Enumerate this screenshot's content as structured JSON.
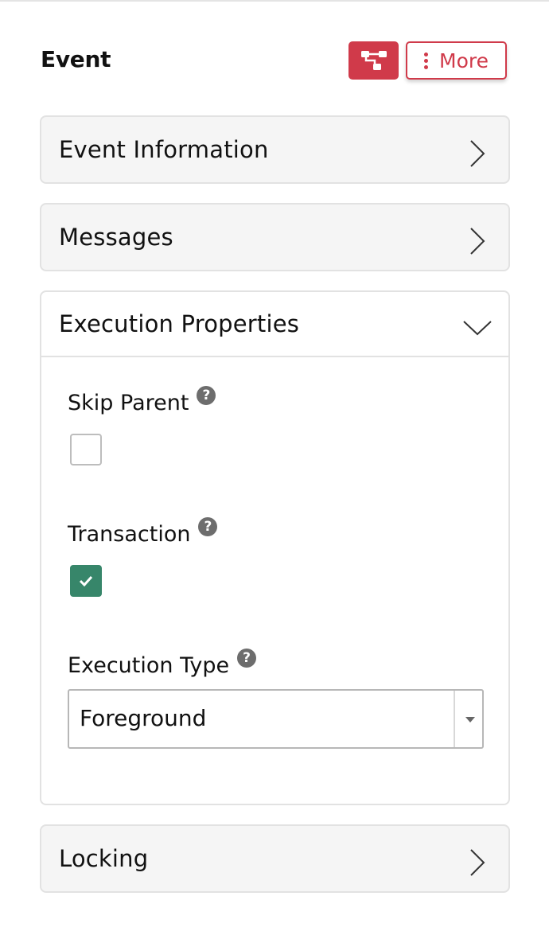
{
  "header": {
    "title": "Event",
    "tree_button_icon": "hierarchy-icon",
    "more_label": "More",
    "more_icon": "kebab-vertical-icon"
  },
  "colors": {
    "accent": "#d03a4a",
    "checked": "#37866a",
    "panel_bg": "#f5f5f5",
    "help_icon": "#6d6d6d"
  },
  "panels": [
    {
      "label": "Event Information",
      "state": "collapsed",
      "icon": "chevron-right-icon"
    },
    {
      "label": "Messages",
      "state": "collapsed",
      "icon": "chevron-right-icon"
    },
    {
      "label": "Execution Properties",
      "state": "expanded",
      "icon": "chevron-down-icon"
    },
    {
      "label": "Locking",
      "state": "collapsed",
      "icon": "chevron-right-icon"
    }
  ],
  "execution": {
    "skip_parent": {
      "label": "Skip Parent",
      "help": "?",
      "checked": false
    },
    "transaction": {
      "label": "Transaction",
      "help": "?",
      "checked": true
    },
    "execution_type": {
      "label": "Execution Type",
      "help": "?",
      "value": "Foreground"
    }
  }
}
